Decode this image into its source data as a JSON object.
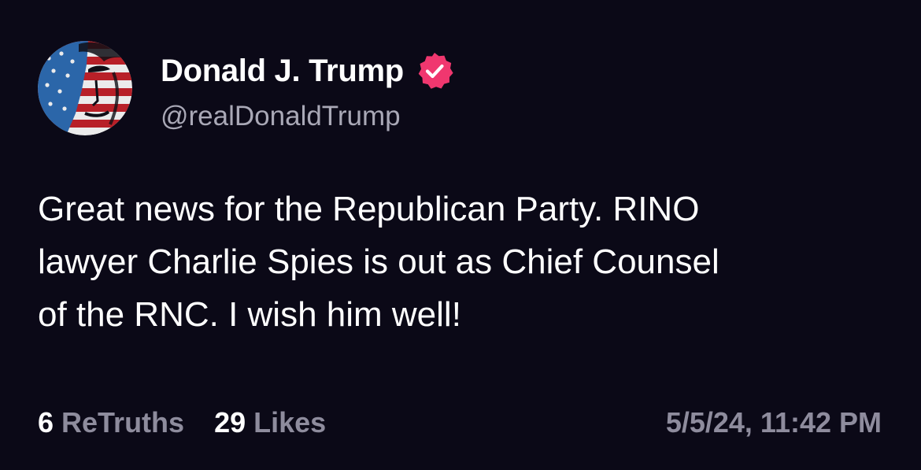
{
  "author": {
    "display_name": "Donald J. Trump",
    "handle": "@realDonaldTrump",
    "avatar_icon": "flag-portrait-avatar",
    "verified_icon": "verified-badge-icon"
  },
  "post": {
    "lines": [
      "Great news for the Republican Party. RINO",
      "lawyer Charlie Spies is out as Chief Counsel",
      "of the RNC. I wish him well!"
    ]
  },
  "stats": {
    "retruths_count": "6",
    "retruths_label": "ReTruths",
    "likes_count": "29",
    "likes_label": "Likes"
  },
  "timestamp": "5/5/24, 11:42 PM",
  "colors": {
    "background": "#0b0917",
    "text_primary": "#ffffff",
    "text_secondary": "#8e8c9d",
    "verified_badge": "#f0376f"
  }
}
